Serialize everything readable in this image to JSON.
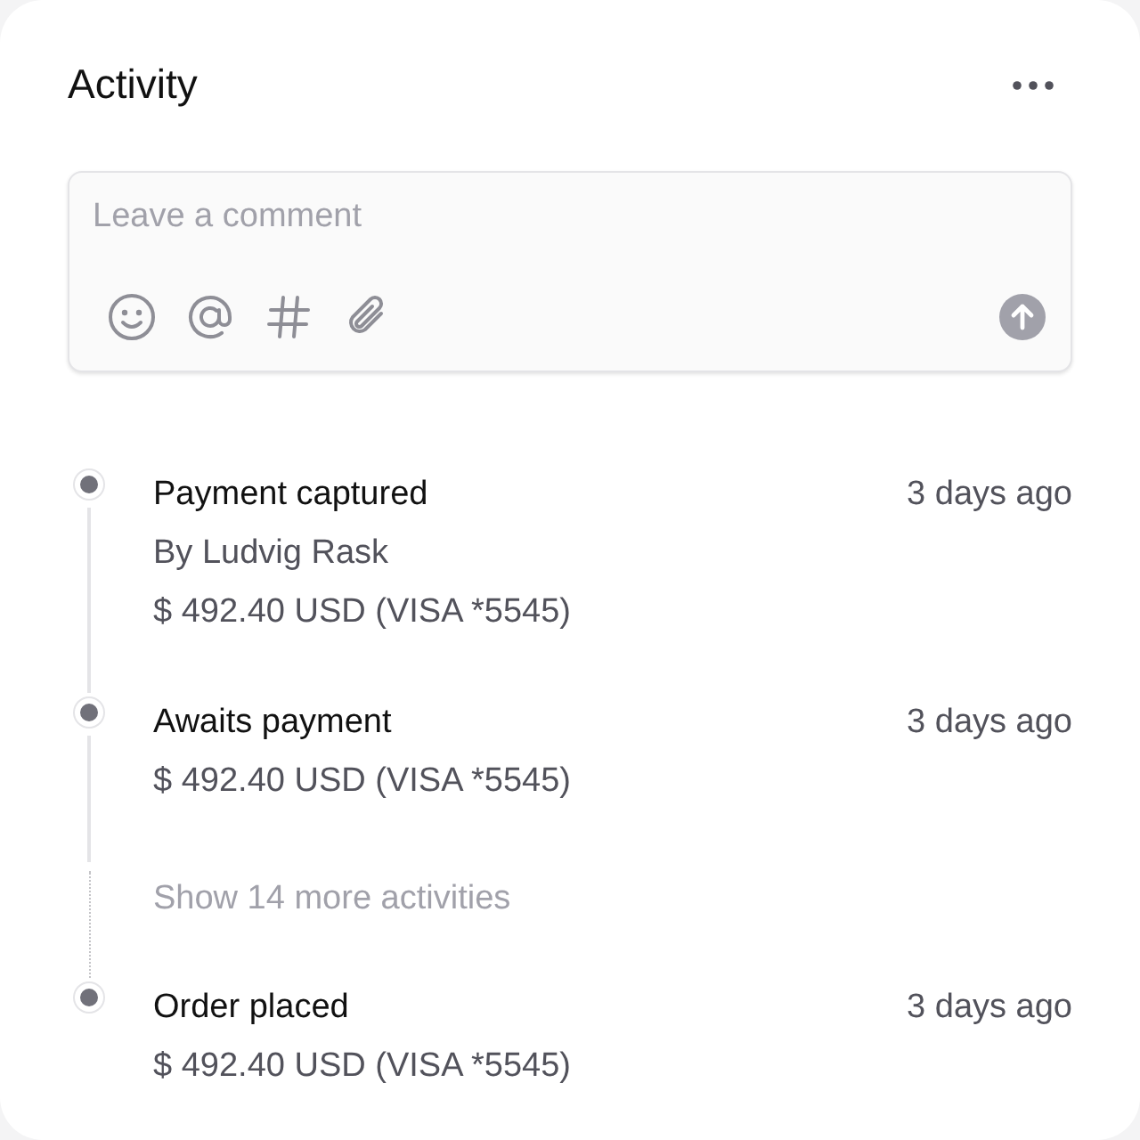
{
  "panel": {
    "title": "Activity"
  },
  "comment": {
    "placeholder": "Leave a comment"
  },
  "activities": [
    {
      "kind": "event",
      "title": "Payment captured",
      "time": "3 days ago",
      "details": [
        "By Ludvig Rask",
        "$ 492.40 USD (VISA *5545)"
      ]
    },
    {
      "kind": "event",
      "title": "Awaits payment",
      "time": "3 days ago",
      "details": [
        "$ 492.40 USD (VISA *5545)"
      ]
    },
    {
      "kind": "more",
      "label": "Show 14 more activities"
    },
    {
      "kind": "event",
      "title": "Order placed",
      "time": "3 days ago",
      "details": [
        "$ 492.40 USD (VISA *5545)"
      ]
    }
  ]
}
